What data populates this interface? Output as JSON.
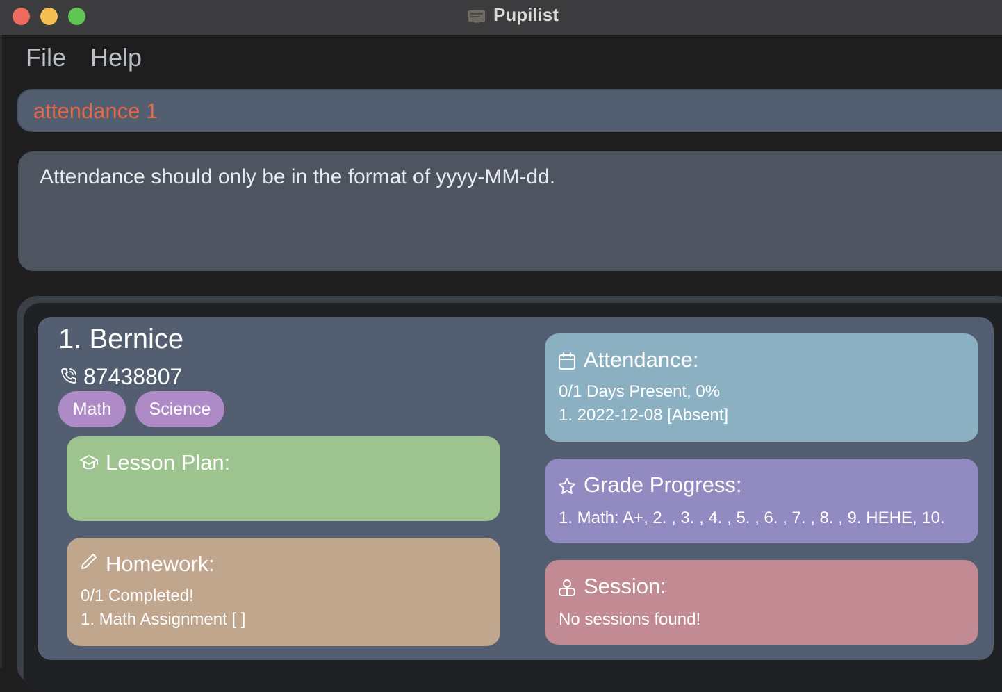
{
  "window": {
    "title": "Pupilist"
  },
  "menu": {
    "items": [
      "File",
      "Help"
    ]
  },
  "command": {
    "value": "attendance 1"
  },
  "result": {
    "message": "Attendance should only be in the format of yyyy-MM-dd."
  },
  "person": {
    "name": "1.  Bernice",
    "phone": "87438807",
    "tags": [
      "Math",
      "Science"
    ],
    "lesson_plan": {
      "title": "Lesson Plan:"
    },
    "homework": {
      "title": "Homework:",
      "summary": "0/1 Completed!",
      "items": [
        "1. Math Assignment [ ]"
      ]
    },
    "attendance": {
      "title": "Attendance:",
      "summary": "0/1 Days Present, 0%",
      "items": [
        "1. 2022-12-08 [Absent]"
      ]
    },
    "grade_progress": {
      "title": "Grade Progress:",
      "items": [
        "1. Math: A+, 2. , 3. , 4. , 5. , 6. , 7. , 8. , 9. HEHE, 10."
      ]
    },
    "session": {
      "title": "Session:",
      "summary": "No sessions found!"
    }
  },
  "colors": {
    "command_text": "#e06a4a",
    "tag": "#ae8ac7",
    "lesson_plan": "#9dc38e",
    "homework": "#c1a68e",
    "attendance": "#8bb0c2",
    "grade_progress": "#918bc1",
    "session": "#c28b93"
  },
  "icons": {
    "phone": "phone-icon",
    "lesson_plan": "graduation-cap-icon",
    "homework": "pencil-icon",
    "attendance": "calendar-icon",
    "grade_progress": "star-icon",
    "session": "user-group-icon"
  }
}
